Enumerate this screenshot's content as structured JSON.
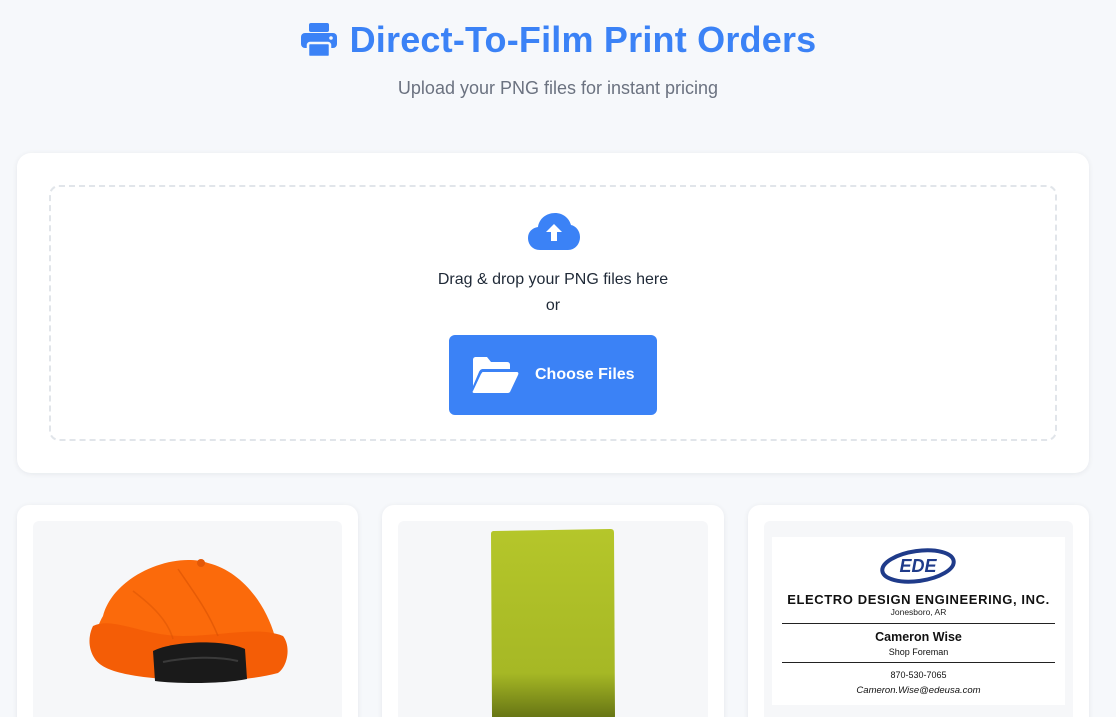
{
  "header": {
    "title": "Direct-To-Film Print Orders",
    "subtitle": "Upload your PNG files for instant pricing",
    "icon": "printer-icon",
    "accent_color": "#3b82f6"
  },
  "upload": {
    "icon": "cloud-upload-icon",
    "drag_text": "Drag & drop your PNG files here",
    "or_text": "or",
    "button_label": "Choose Files",
    "button_icon": "folder-open-icon",
    "button_color": "#3b82f6"
  },
  "products": [
    {
      "item": "orange-cap-image"
    },
    {
      "item": "lime-green-panel-image"
    },
    {
      "item": "business-card-image",
      "card": {
        "logo_text": "EDE",
        "company": "ELECTRO DESIGN ENGINEERING, INC.",
        "city": "Jonesboro, AR",
        "name": "Cameron Wise",
        "role": "Shop Foreman",
        "phone": "870-530-7065",
        "email": "Cameron.Wise@edeusa.com"
      }
    }
  ]
}
